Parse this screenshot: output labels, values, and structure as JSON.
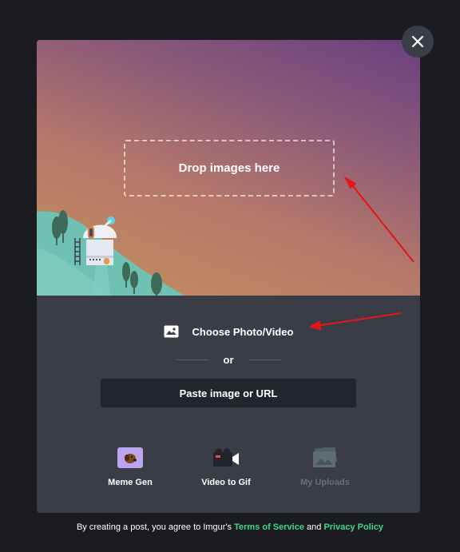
{
  "dropzone": {
    "label": "Drop images here"
  },
  "upload": {
    "choose_label": "Choose Photo/Video",
    "or_label": "or",
    "paste_label": "Paste image or URL"
  },
  "tools": [
    {
      "label": "Meme Gen",
      "icon": "meme-icon",
      "enabled": true
    },
    {
      "label": "Video to Gif",
      "icon": "video-camera-icon",
      "enabled": true
    },
    {
      "label": "My Uploads",
      "icon": "photos-icon",
      "enabled": false
    }
  ],
  "footer": {
    "prefix": "By creating a post, you agree to Imgur's",
    "tos": "Terms of Service",
    "and": "and",
    "privacy": "Privacy Policy"
  },
  "colors": {
    "accent_green": "#3bd78e",
    "annotation_red": "#e8141a",
    "panel": "#3a3d46",
    "background": "#1b1c21"
  }
}
